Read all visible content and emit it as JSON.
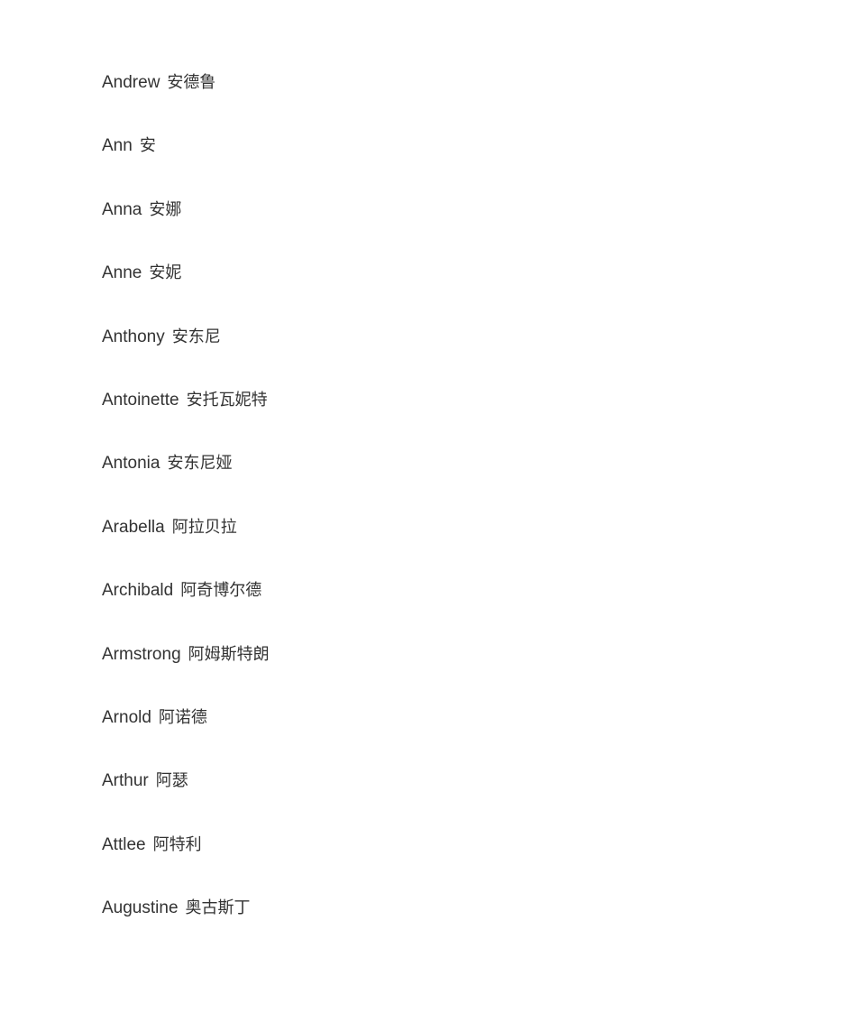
{
  "document": {
    "entries": [
      {
        "english": "Andrew",
        "chinese": "安德鲁"
      },
      {
        "english": "Ann",
        "chinese": "安"
      },
      {
        "english": "Anna",
        "chinese": "安娜"
      },
      {
        "english": "Anne",
        "chinese": "安妮"
      },
      {
        "english": "Anthony",
        "chinese": "安东尼"
      },
      {
        "english": "Antoinette",
        "chinese": "安托瓦妮特"
      },
      {
        "english": "Antonia",
        "chinese": "安东尼娅"
      },
      {
        "english": "Arabella",
        "chinese": "阿拉贝拉"
      },
      {
        "english": "Archibald",
        "chinese": "阿奇博尔德"
      },
      {
        "english": "Armstrong",
        "chinese": "阿姆斯特朗"
      },
      {
        "english": "Arnold",
        "chinese": "阿诺德"
      },
      {
        "english": "Arthur",
        "chinese": "阿瑟"
      },
      {
        "english": "Attlee",
        "chinese": "阿特利"
      },
      {
        "english": "Augustine",
        "chinese": "奥古斯丁"
      }
    ],
    "colors": {
      "text": "#333333",
      "background": "#ffffff"
    }
  }
}
